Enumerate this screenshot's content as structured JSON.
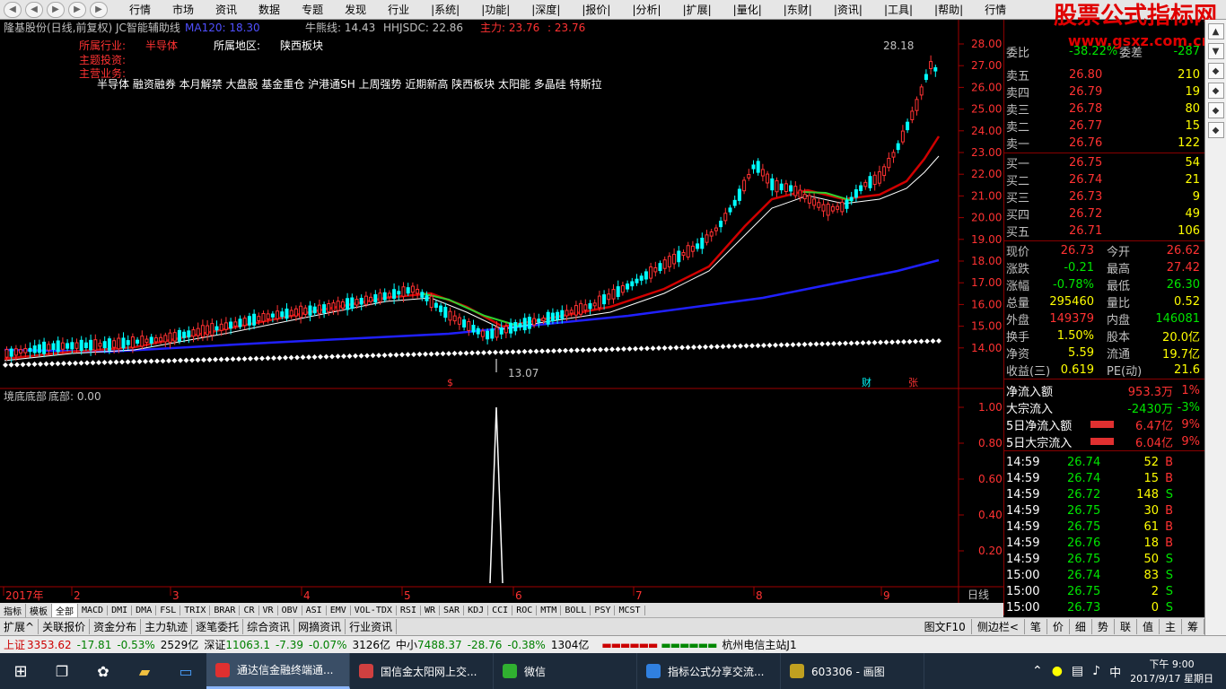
{
  "menu": {
    "items": [
      "行情",
      "市场",
      "资讯",
      "数据",
      "专题",
      "发现",
      "行业",
      "|系统|",
      "|功能|",
      "|深度|",
      "|报价|",
      "|分析|",
      "|扩展|",
      "|量化|",
      "|东财|",
      "|资讯|",
      "|工具|",
      "|帮助|",
      "行情"
    ],
    "nav": [
      "◀",
      "◀",
      "▶",
      "▶",
      "▶"
    ]
  },
  "brand": {
    "name": "股票公式指标网",
    "url": "www.gsxz.com.cn"
  },
  "chart_header": {
    "title": "隆基股份(日线,前复权) JC智能辅助线",
    "ma120": "MA120: 18.30",
    "niu": "牛熊线: 14.43",
    "hhjs": "HHJSDC: 22.86",
    "zhuli": "主力: 23.76",
    "zhuli2": ": 23.76",
    "industry_label": "所属行业:",
    "industry": "半导体",
    "region_label": "所属地区:",
    "region": "陕西板块",
    "theme_label": "主题投资:",
    "business_label": "主营业务:",
    "concepts": "半导体 融资融券 本月解禁 大盘股 基金重仓 沪港通SH 上周强势 近期新高 陕西板块 太阳能 多晶硅 特斯拉",
    "high_label": "28.18",
    "low_label": "13.07",
    "flag_s": "$",
    "flag_cai": "财",
    "flag_zhang": "张"
  },
  "price_axis": [
    "28.00",
    "27.00",
    "26.00",
    "25.00",
    "24.00",
    "23.00",
    "22.00",
    "21.00",
    "20.00",
    "19.00",
    "18.00",
    "17.00",
    "16.00",
    "15.00",
    "14.00"
  ],
  "sub_header": {
    "title": "境底底部",
    "value": "底部: 0.00"
  },
  "sub_axis": [
    "1.00",
    "0.80",
    "0.60",
    "0.40",
    "0.20"
  ],
  "time_axis": [
    "2017年",
    "2",
    "3",
    "4",
    "5",
    "6",
    "7",
    "8",
    "9"
  ],
  "period": "日线",
  "quote": {
    "wei": {
      "label": "委比",
      "value": "-38.22%",
      "label2": "委差",
      "value2": "-287"
    },
    "asks": [
      {
        "label": "卖五",
        "price": "26.80",
        "vol": "210"
      },
      {
        "label": "卖四",
        "price": "26.79",
        "vol": "19"
      },
      {
        "label": "卖三",
        "price": "26.78",
        "vol": "80"
      },
      {
        "label": "卖二",
        "price": "26.77",
        "vol": "15"
      },
      {
        "label": "卖一",
        "price": "26.76",
        "vol": "122"
      }
    ],
    "bids": [
      {
        "label": "买一",
        "price": "26.75",
        "vol": "54"
      },
      {
        "label": "买二",
        "price": "26.74",
        "vol": "21"
      },
      {
        "label": "买三",
        "price": "26.73",
        "vol": "9"
      },
      {
        "label": "买四",
        "price": "26.72",
        "vol": "49"
      },
      {
        "label": "买五",
        "price": "26.71",
        "vol": "106"
      }
    ],
    "stats": [
      [
        "现价",
        "26.73",
        "今开",
        "26.62"
      ],
      [
        "涨跌",
        "-0.21",
        "最高",
        "27.42"
      ],
      [
        "涨幅",
        "-0.78%",
        "最低",
        "26.30"
      ],
      [
        "总量",
        "295460",
        "量比",
        "0.52"
      ],
      [
        "外盘",
        "149379",
        "内盘",
        "146081"
      ],
      [
        "换手",
        "1.50%",
        "股本",
        "20.0亿"
      ],
      [
        "净资",
        "5.59",
        "流通",
        "19.7亿"
      ],
      [
        "收益(三)",
        "0.619",
        "PE(动)",
        "21.6"
      ]
    ],
    "flows": [
      [
        "净流入额",
        "953.3万",
        "1%"
      ],
      [
        "大宗流入",
        "-2430万",
        "-3%"
      ],
      [
        "5日净流入额",
        "6.47亿",
        "9%"
      ],
      [
        "5日大宗流入",
        "6.04亿",
        "9%"
      ]
    ],
    "ticks": [
      [
        "14:59",
        "26.74",
        "52",
        "B"
      ],
      [
        "14:59",
        "26.74",
        "15",
        "B"
      ],
      [
        "14:59",
        "26.72",
        "148",
        "S"
      ],
      [
        "14:59",
        "26.75",
        "30",
        "B"
      ],
      [
        "14:59",
        "26.75",
        "61",
        "B"
      ],
      [
        "14:59",
        "26.76",
        "18",
        "B"
      ],
      [
        "14:59",
        "26.75",
        "50",
        "S"
      ],
      [
        "15:00",
        "26.74",
        "83",
        "S"
      ],
      [
        "15:00",
        "26.75",
        "2",
        "S"
      ],
      [
        "15:00",
        "26.73",
        "0",
        "S"
      ]
    ]
  },
  "ind_tabs": [
    "指标",
    "模板",
    "全部",
    "MACD",
    "DMI",
    "DMA",
    "FSL",
    "TRIX",
    "BRAR",
    "CR",
    "VR",
    "OBV",
    "ASI",
    "EMV",
    "VOL-TDX",
    "RSI",
    "WR",
    "SAR",
    "KDJ",
    "CCI",
    "ROC",
    "MTM",
    "BOLL",
    "PSY",
    "MCST"
  ],
  "bottom_tabs": [
    "扩展^",
    "关联报价",
    "资金分布",
    "主力轨迹",
    "逐笔委托",
    "综合资讯",
    "网摘资讯",
    "行业资讯"
  ],
  "bottom_right": [
    "图文F10",
    "侧边栏<",
    "笔",
    "价",
    "细",
    "势",
    "联",
    "值",
    "主",
    "筹"
  ],
  "status": {
    "sh_label": "上证",
    "sh": "3353.62",
    "sh_chg": "-17.81",
    "sh_pct": "-0.53%",
    "sh_amt": "2529亿",
    "sz_label": "深证",
    "sz": "11063.1",
    "sz_chg": "-7.39",
    "sz_pct": "-0.07%",
    "sz_amt": "3126亿",
    "zx_label": "中小",
    "zx": "7488.37",
    "zx_chg": "-28.76",
    "zx_pct": "-0.38%",
    "zx_amt": "1304亿",
    "site": "杭州电信主站J1"
  },
  "taskbar": {
    "tasks": [
      "通达信金融终端通...",
      "国信金太阳网上交...",
      "微信",
      "指标公式分享交流...",
      "603306 - 画图"
    ],
    "time": "下午 9:00",
    "date": "2017/9/17 星期日"
  }
}
